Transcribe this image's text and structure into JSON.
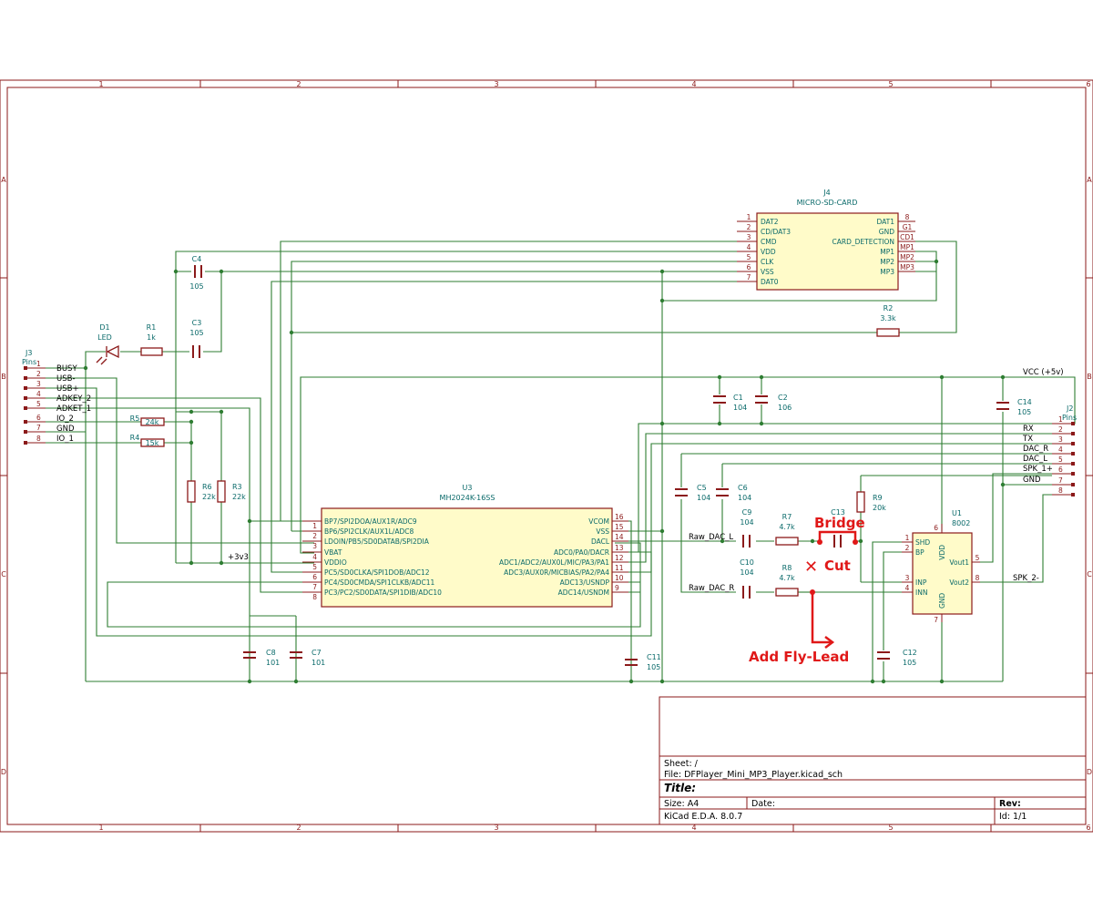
{
  "frame": {
    "columns": [
      "1",
      "2",
      "3",
      "4",
      "5",
      "6"
    ],
    "rows": [
      "A",
      "B",
      "C",
      "D"
    ]
  },
  "title_block": {
    "sheet_label": "Sheet: /",
    "file_label": "File: DFPlayer_Mini_MP3_Player.kicad_sch",
    "title_label": "Title:",
    "size_label": "Size: A4",
    "date_label": "Date:",
    "rev_label": "Rev:",
    "tool_label": "KiCad E.D.A. 8.0.7",
    "id_label": "Id: 1/1"
  },
  "j4": {
    "ref": "J4",
    "value": "MICRO-SD-CARD",
    "left_pins": [
      {
        "num": "1",
        "name": "DAT2"
      },
      {
        "num": "2",
        "name": "CD/DAT3"
      },
      {
        "num": "3",
        "name": "CMD"
      },
      {
        "num": "4",
        "name": "VDD"
      },
      {
        "num": "5",
        "name": "CLK"
      },
      {
        "num": "6",
        "name": "VSS"
      },
      {
        "num": "7",
        "name": "DAT0"
      }
    ],
    "right_pins": [
      {
        "num": "8",
        "name": "DAT1"
      },
      {
        "num": "G1",
        "name": "GND"
      },
      {
        "num": "CD1",
        "name": "CARD_DETECTION"
      },
      {
        "num": "MP1",
        "name": "MP1"
      },
      {
        "num": "MP2",
        "name": "MP2"
      },
      {
        "num": "MP3",
        "name": "MP3"
      }
    ]
  },
  "u3": {
    "ref": "U3",
    "value": "MH2024K-16SS",
    "left_pins": [
      {
        "num": "1",
        "name": "BP7/SPI2DOA/AUX1R/ADC9"
      },
      {
        "num": "2",
        "name": "BP6/SPI2CLK/AUX1L/ADC8"
      },
      {
        "num": "3",
        "name": "LDOIN/PB5/SD0DATAB/SPI2DIA"
      },
      {
        "num": "4",
        "name": "VBAT"
      },
      {
        "num": "5",
        "name": "VDDIO"
      },
      {
        "num": "6",
        "name": "PC5/SD0CLKA/SPI1DOB/ADC12"
      },
      {
        "num": "7",
        "name": "PC4/SD0CMDA/SPI1CLKB/ADC11"
      },
      {
        "num": "8",
        "name": "PC3/PC2/SD0DATA/SPI1DIB/ADC10"
      }
    ],
    "right_pins": [
      {
        "num": "16",
        "name": "VCOM"
      },
      {
        "num": "15",
        "name": "VSS"
      },
      {
        "num": "14",
        "name": "DACL"
      },
      {
        "num": "13",
        "name": "ADC0/PA0/DACR"
      },
      {
        "num": "12",
        "name": "ADC1/ADC2/AUX0L/MIC/PA3/PA1"
      },
      {
        "num": "11",
        "name": "ADC3/AUX0R/MICBIAS/PA2/PA4"
      },
      {
        "num": "10",
        "name": "ADC13/USNDP"
      },
      {
        "num": "9",
        "name": "ADC14/USNDM"
      }
    ]
  },
  "u1": {
    "ref": "U1",
    "value": "8002",
    "left_pins": [
      {
        "num": "1",
        "name": "SHD"
      },
      {
        "num": "2",
        "name": "BP"
      },
      {
        "num": "3",
        "name": "INP"
      },
      {
        "num": "4",
        "name": "INN"
      }
    ],
    "right_pins": [
      {
        "num": "5",
        "name": "Vout1"
      },
      {
        "num": "8",
        "name": "Vout2"
      }
    ],
    "top_pin": {
      "num": "6",
      "name": "VDD"
    },
    "bottom_pin": {
      "num": "7",
      "name": "GND"
    }
  },
  "j3": {
    "ref": "J3",
    "value": "Pins",
    "pins": [
      {
        "num": "1",
        "net": "BUSY"
      },
      {
        "num": "2",
        "net": "USB-"
      },
      {
        "num": "3",
        "net": "USB+"
      },
      {
        "num": "4",
        "net": "ADKEY_2"
      },
      {
        "num": "5",
        "net": "ADKET_1"
      },
      {
        "num": "6",
        "net": "IO_2"
      },
      {
        "num": "7",
        "net": "GND"
      },
      {
        "num": "8",
        "net": "IO_1"
      }
    ]
  },
  "j2": {
    "ref": "J2",
    "value": "Pins",
    "pins": [
      {
        "num": "1",
        "net": "VCC (+5v)"
      },
      {
        "num": "2",
        "net": "RX"
      },
      {
        "num": "3",
        "net": "TX"
      },
      {
        "num": "4",
        "net": "DAC_R"
      },
      {
        "num": "5",
        "net": "DAC_L"
      },
      {
        "num": "6",
        "net": "SPK_1+"
      },
      {
        "num": "7",
        "net": "GND"
      },
      {
        "num": "8",
        "net": ""
      }
    ]
  },
  "parts": {
    "d1": {
      "ref": "D1",
      "value": "LED"
    },
    "r1": {
      "ref": "R1",
      "value": "1k"
    },
    "r2": {
      "ref": "R2",
      "value": "3.3k"
    },
    "r3": {
      "ref": "R3",
      "value": "22k"
    },
    "r4": {
      "ref": "R4",
      "value": "15k"
    },
    "r5": {
      "ref": "R5",
      "value": "24k"
    },
    "r6": {
      "ref": "R6",
      "value": "22k"
    },
    "r7": {
      "ref": "R7",
      "value": "4.7k"
    },
    "r8": {
      "ref": "R8",
      "value": "4.7k"
    },
    "r9": {
      "ref": "R9",
      "value": "20k"
    },
    "c1": {
      "ref": "C1",
      "value": "104"
    },
    "c2": {
      "ref": "C2",
      "value": "106"
    },
    "c3": {
      "ref": "C3",
      "value": "105"
    },
    "c4": {
      "ref": "C4",
      "value": "105"
    },
    "c5": {
      "ref": "C5",
      "value": "104"
    },
    "c6": {
      "ref": "C6",
      "value": "104"
    },
    "c7": {
      "ref": "C7",
      "value": "101"
    },
    "c8": {
      "ref": "C8",
      "value": "101"
    },
    "c9": {
      "ref": "C9",
      "value": "104"
    },
    "c10": {
      "ref": "C10",
      "value": "104"
    },
    "c11": {
      "ref": "C11",
      "value": "105"
    },
    "c12": {
      "ref": "C12",
      "value": "105"
    },
    "c13": {
      "ref": "C13",
      "value": ""
    },
    "c14": {
      "ref": "C14",
      "value": "105"
    }
  },
  "nets": {
    "v33": "+3v3",
    "raw_dac_l": "Raw_DAC_L",
    "raw_dac_r": "Raw_DAC_R",
    "spk2": "SPK_2-"
  },
  "annotations": {
    "bridge": "Bridge",
    "cut": "Cut",
    "cut_mark": "✕",
    "fly_lead": "Add Fly-Lead",
    "color": "#e01818"
  },
  "colors": {
    "wire": "#2e7d32",
    "component_outline": "#8b1a1a",
    "component_fill": "#fffbc9",
    "reference_text": "#0a6a6a"
  }
}
